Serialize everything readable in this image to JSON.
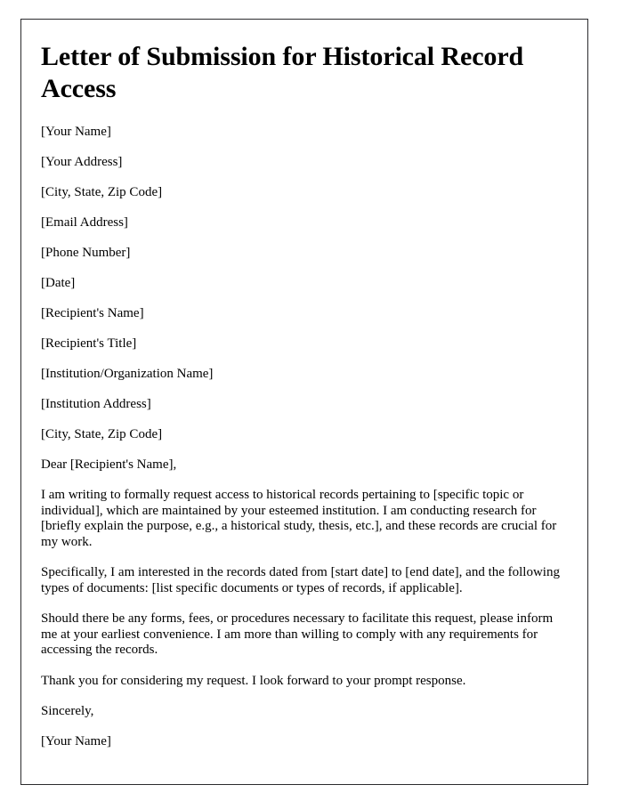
{
  "document": {
    "title": "Letter of Submission for Historical Record Access",
    "sender_fields": [
      "[Your Name]",
      "[Your Address]",
      "[City, State, Zip Code]",
      "[Email Address]",
      "[Phone Number]",
      "[Date]"
    ],
    "recipient_fields": [
      "[Recipient's Name]",
      "[Recipient's Title]",
      "[Institution/Organization Name]",
      "[Institution Address]",
      "[City, State, Zip Code]"
    ],
    "salutation": "Dear [Recipient's Name],",
    "paragraphs": [
      "I am writing to formally request access to historical records pertaining to [specific topic or individual], which are maintained by your esteemed institution. I am conducting research for [briefly explain the purpose, e.g., a historical study, thesis, etc.], and these records are crucial for my work.",
      "Specifically, I am interested in the records dated from [start date] to [end date], and the following types of documents: [list specific documents or types of records, if applicable].",
      "Should there be any forms, fees, or procedures necessary to facilitate this request, please inform me at your earliest convenience. I am more than willing to comply with any requirements for accessing the records.",
      "Thank you for considering my request. I look forward to your prompt response."
    ],
    "closing": "Sincerely,",
    "signature_name": "[Your Name]",
    "colors": {
      "text": "#000000",
      "border": "#2b2b2e",
      "background": "#ffffff"
    }
  }
}
